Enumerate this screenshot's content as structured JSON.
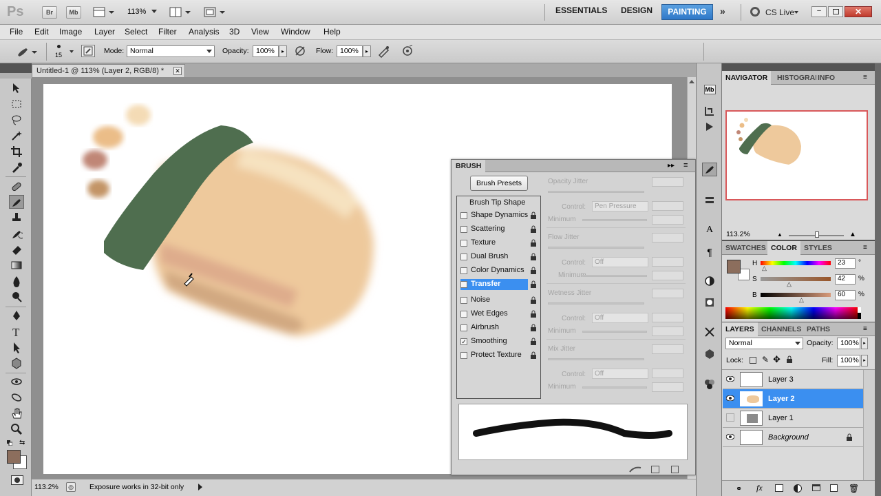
{
  "appbar": {
    "logo": "Ps",
    "br": "Br",
    "mb": "Mb",
    "zoom": "113%",
    "workspaces": [
      "ESSENTIALS",
      "DESIGN",
      "PAINTING"
    ],
    "cslive": "CS Live"
  },
  "menu": [
    "File",
    "Edit",
    "Image",
    "Layer",
    "Select",
    "Filter",
    "Analysis",
    "3D",
    "View",
    "Window",
    "Help"
  ],
  "options": {
    "brush_size": "15",
    "mode_label": "Mode:",
    "mode_value": "Normal",
    "opacity_label": "Opacity:",
    "opacity_value": "100%",
    "flow_label": "Flow:",
    "flow_value": "100%"
  },
  "document": {
    "tab_title": "Untitled-1 @ 113% (Layer 2, RGB/8) *"
  },
  "status": {
    "zoom": "113.2%",
    "message": "Exposure works in 32-bit only"
  },
  "navigator": {
    "tabs": [
      "NAVIGATOR",
      "HISTOGRAM",
      "INFO"
    ],
    "zoom": "113.2%"
  },
  "color": {
    "tabs": [
      "SWATCHES",
      "COLOR",
      "STYLES"
    ],
    "h_label": "H",
    "h_value": "23",
    "h_unit": "°",
    "s_label": "S",
    "s_value": "42",
    "s_unit": "%",
    "b_label": "B",
    "b_value": "60",
    "b_unit": "%",
    "fg_color": "#8c6e5d"
  },
  "layers": {
    "tabs": [
      "LAYERS",
      "CHANNELS",
      "PATHS"
    ],
    "blend_mode": "Normal",
    "opacity_label": "Opacity:",
    "opacity_value": "100%",
    "lock_label": "Lock:",
    "fill_label": "Fill:",
    "fill_value": "100%",
    "items": [
      {
        "name": "Layer 3",
        "visible": true,
        "selected": false
      },
      {
        "name": "Layer 2",
        "visible": true,
        "selected": true
      },
      {
        "name": "Layer 1",
        "visible": false,
        "selected": false
      },
      {
        "name": "Background",
        "visible": true,
        "selected": false
      }
    ]
  },
  "brush": {
    "title": "BRUSH",
    "presets_button": "Brush Presets",
    "tip_shape": "Brush Tip Shape",
    "items": [
      {
        "label": "Shape Dynamics",
        "checked": false
      },
      {
        "label": "Scattering",
        "checked": false
      },
      {
        "label": "Texture",
        "checked": false
      },
      {
        "label": "Dual Brush",
        "checked": false
      },
      {
        "label": "Color Dynamics",
        "checked": false
      },
      {
        "label": "Transfer",
        "checked": false,
        "selected": true
      },
      {
        "label": "Noise",
        "checked": false
      },
      {
        "label": "Wet Edges",
        "checked": false
      },
      {
        "label": "Airbrush",
        "checked": false
      },
      {
        "label": "Smoothing",
        "checked": true
      },
      {
        "label": "Protect Texture",
        "checked": false
      }
    ],
    "settings": {
      "opacity_jitter": "Opacity Jitter",
      "control_label": "Control:",
      "control1": "Pen Pressure",
      "minimum": "Minimum",
      "flow_jitter": "Flow Jitter",
      "control2": "Off",
      "wetness_jitter": "Wetness Jitter",
      "control3": "Off",
      "mix_jitter": "Mix Jitter",
      "control4": "Off"
    }
  },
  "colors": {
    "green_stroke": "#4f6e4f",
    "peach": "#eec99c",
    "selection_blue": "#3b8ff0"
  }
}
